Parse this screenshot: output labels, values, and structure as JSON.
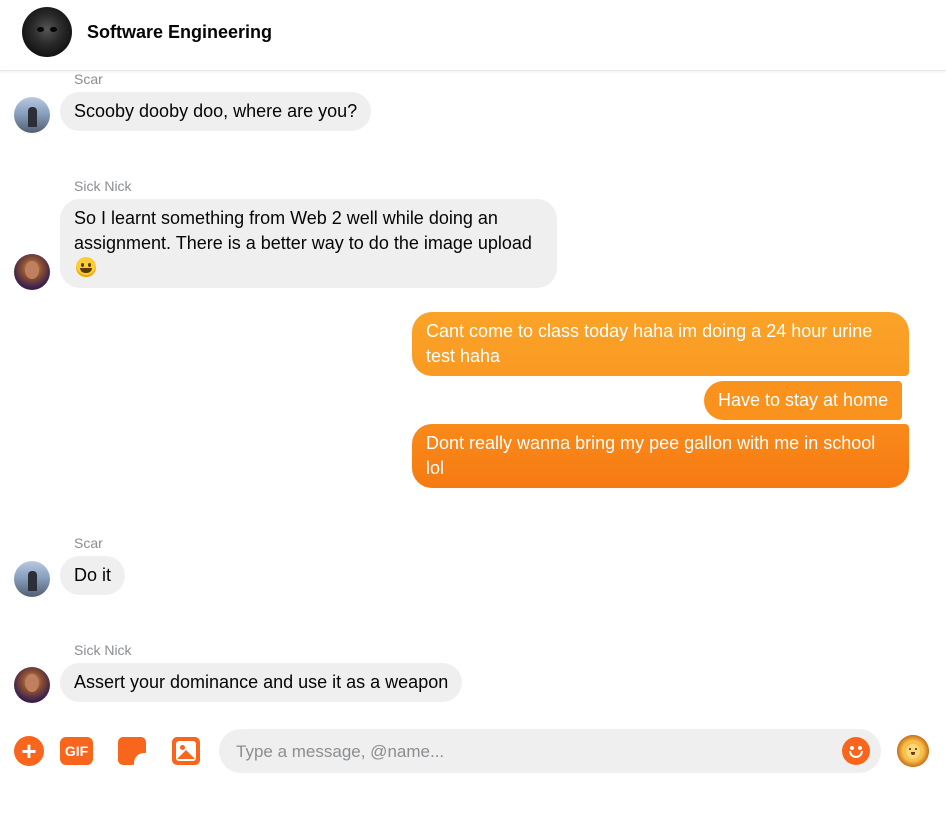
{
  "header": {
    "title": "Software Engineering"
  },
  "messages": [
    {
      "sender": "Scar",
      "text": "Scooby dooby doo, where are you?"
    },
    {
      "sender": "Sick Nick",
      "text": "So I learnt something from Web 2 well while doing  an assignment. There is a better way to do the image upload"
    },
    {
      "sender": "me",
      "text": "Cant come to class today haha im doing a 24 hour urine test haha"
    },
    {
      "sender": "me",
      "text": "Have to stay at home"
    },
    {
      "sender": "me",
      "text": "Dont really wanna bring my pee gallon with me in school lol"
    },
    {
      "sender": "Scar",
      "text": "Do it"
    },
    {
      "sender": "Sick Nick",
      "text": "Assert your dominance and use it as a weapon"
    }
  ],
  "composer": {
    "placeholder": "Type a message, @name...",
    "value": "",
    "gif_label": "GIF",
    "plus_label": "+"
  },
  "colors": {
    "accent": "#f8651c",
    "bubble_in": "#efefef",
    "bubble_out": "#f9931d"
  }
}
